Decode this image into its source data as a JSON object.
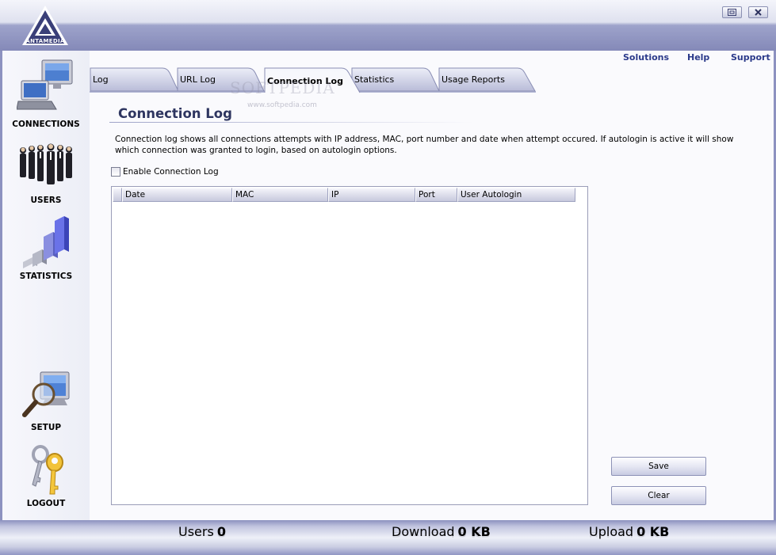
{
  "app": {
    "logo_text": "ANTAMEDIA"
  },
  "window_controls": {
    "restore_icon": "restore-icon",
    "close_icon": "close-icon"
  },
  "nav": {
    "items": [
      {
        "label": "CONNECTIONS",
        "icon": "computer-icon"
      },
      {
        "label": "USERS",
        "icon": "users-group-icon"
      },
      {
        "label": "STATISTICS",
        "icon": "bar-chart-icon"
      },
      {
        "label": "SETUP",
        "icon": "magnifier-monitor-icon"
      },
      {
        "label": "LOGOUT",
        "icon": "keys-icon"
      }
    ]
  },
  "top_links": {
    "solutions": "Solutions",
    "help": "Help",
    "support": "Support"
  },
  "tabs": [
    {
      "label": "Log",
      "active": false
    },
    {
      "label": "URL Log",
      "active": false
    },
    {
      "label": "Connection Log",
      "active": true
    },
    {
      "label": "Statistics",
      "active": false
    },
    {
      "label": "Usage Reports",
      "active": false
    }
  ],
  "watermark": {
    "main": "SOFTPEDIA",
    "sub": "www.softpedia.com"
  },
  "content": {
    "title": "Connection Log",
    "description": "Connection log shows all connections attempts with IP address, MAC, port number and date when attempt occured. If autologin is active it will show which connection was granted to login, based on autologin options.",
    "enable_label": "Enable Connection Log",
    "enable_checked": false
  },
  "table": {
    "columns": [
      "Date",
      "MAC",
      "IP",
      "Port",
      "User Autologin"
    ],
    "rows": []
  },
  "buttons": {
    "save": "Save",
    "clear": "Clear"
  },
  "status": {
    "users_label": "Users",
    "users_value": "0",
    "download_label": "Download",
    "download_value": "0 KB",
    "upload_label": "Upload",
    "upload_value": "0 KB"
  },
  "colors": {
    "accent": "#8d92c0",
    "title": "#2e3560",
    "link": "#2b3a8a"
  }
}
